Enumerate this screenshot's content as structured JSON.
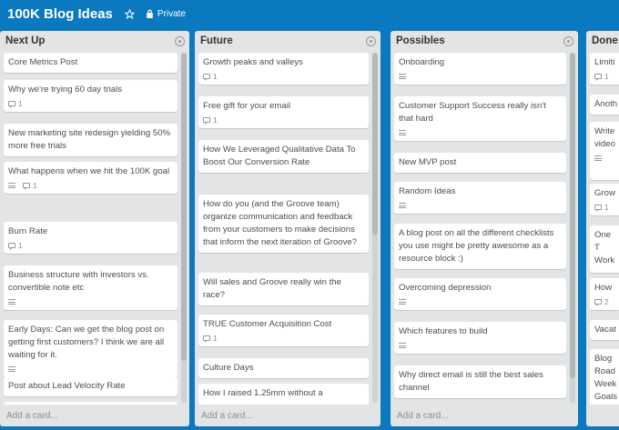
{
  "board": {
    "title": "100K Blog Ideas",
    "privacy": "Private",
    "star_icon": "star-icon",
    "privacy_icon": "lock-icon"
  },
  "lists": [
    {
      "title": "Next Up",
      "add_card": "Add a card...",
      "cards": [
        {
          "title": "Core Metrics Post"
        },
        {
          "title": "Why we're trying 60 day trials",
          "comments": "1"
        },
        {
          "title": "New marketing site redesign yielding 50% more free trials"
        },
        {
          "title": "What happens when we hit the 100K goal",
          "description": true,
          "comments": "1"
        },
        {
          "title": "Burn Rate",
          "comments": "1"
        },
        {
          "title": "Business structure with investors vs. convertible note etc",
          "description": true
        },
        {
          "title": "Early Days: Can we get the blog post on getting first customers? I think we are all waiting for it.",
          "description": true
        },
        {
          "title": "Post about Lead Velocity Rate"
        },
        {
          "title": ""
        }
      ]
    },
    {
      "title": "Future",
      "add_card": "Add a card...",
      "cards": [
        {
          "title": "Growth peaks and valleys",
          "comments": "1"
        },
        {
          "title": "Free gift for your email",
          "comments": "1"
        },
        {
          "title": "How We Leveraged Qualitative Data To Boost Our Conversion Rate"
        },
        {
          "title": "How do you (and the Groove team) organize communication and feedback from your customers to make decisions that inform the next iteration of Groove?"
        },
        {
          "title": "Will sales and Groove really win the race?"
        },
        {
          "title": "TRUE Customer Acquisition Cost",
          "comments": "1"
        },
        {
          "title": "Culture Days"
        },
        {
          "title": "How I raised 1.25mm without a"
        }
      ]
    },
    {
      "title": "Possibles",
      "add_card": "Add a card...",
      "cards": [
        {
          "title": "Onboarding",
          "description": true
        },
        {
          "title": "Customer Support Success really isn't that hard",
          "description": true
        },
        {
          "title": "New MVP post"
        },
        {
          "title": "Random Ideas",
          "description": true
        },
        {
          "title": "A blog post on all the different checklists you use might be pretty awesome as a resource block :)"
        },
        {
          "title": "Overcoming depression",
          "description": true
        },
        {
          "title": "Which features to build",
          "description": true
        },
        {
          "title": "Why direct email is still the best sales channel"
        }
      ]
    },
    {
      "title": "Done",
      "add_card": "",
      "cards": [
        {
          "title": "Limiti",
          "comments": "1"
        },
        {
          "title": "Anoth"
        },
        {
          "title": "Write video",
          "description": true
        },
        {
          "title": "Grow",
          "comments": "1"
        },
        {
          "title": "One T Work"
        },
        {
          "title": "How",
          "comments": "2"
        },
        {
          "title": "Vacat"
        },
        {
          "title": "Blog Road Week Goals"
        }
      ]
    }
  ]
}
